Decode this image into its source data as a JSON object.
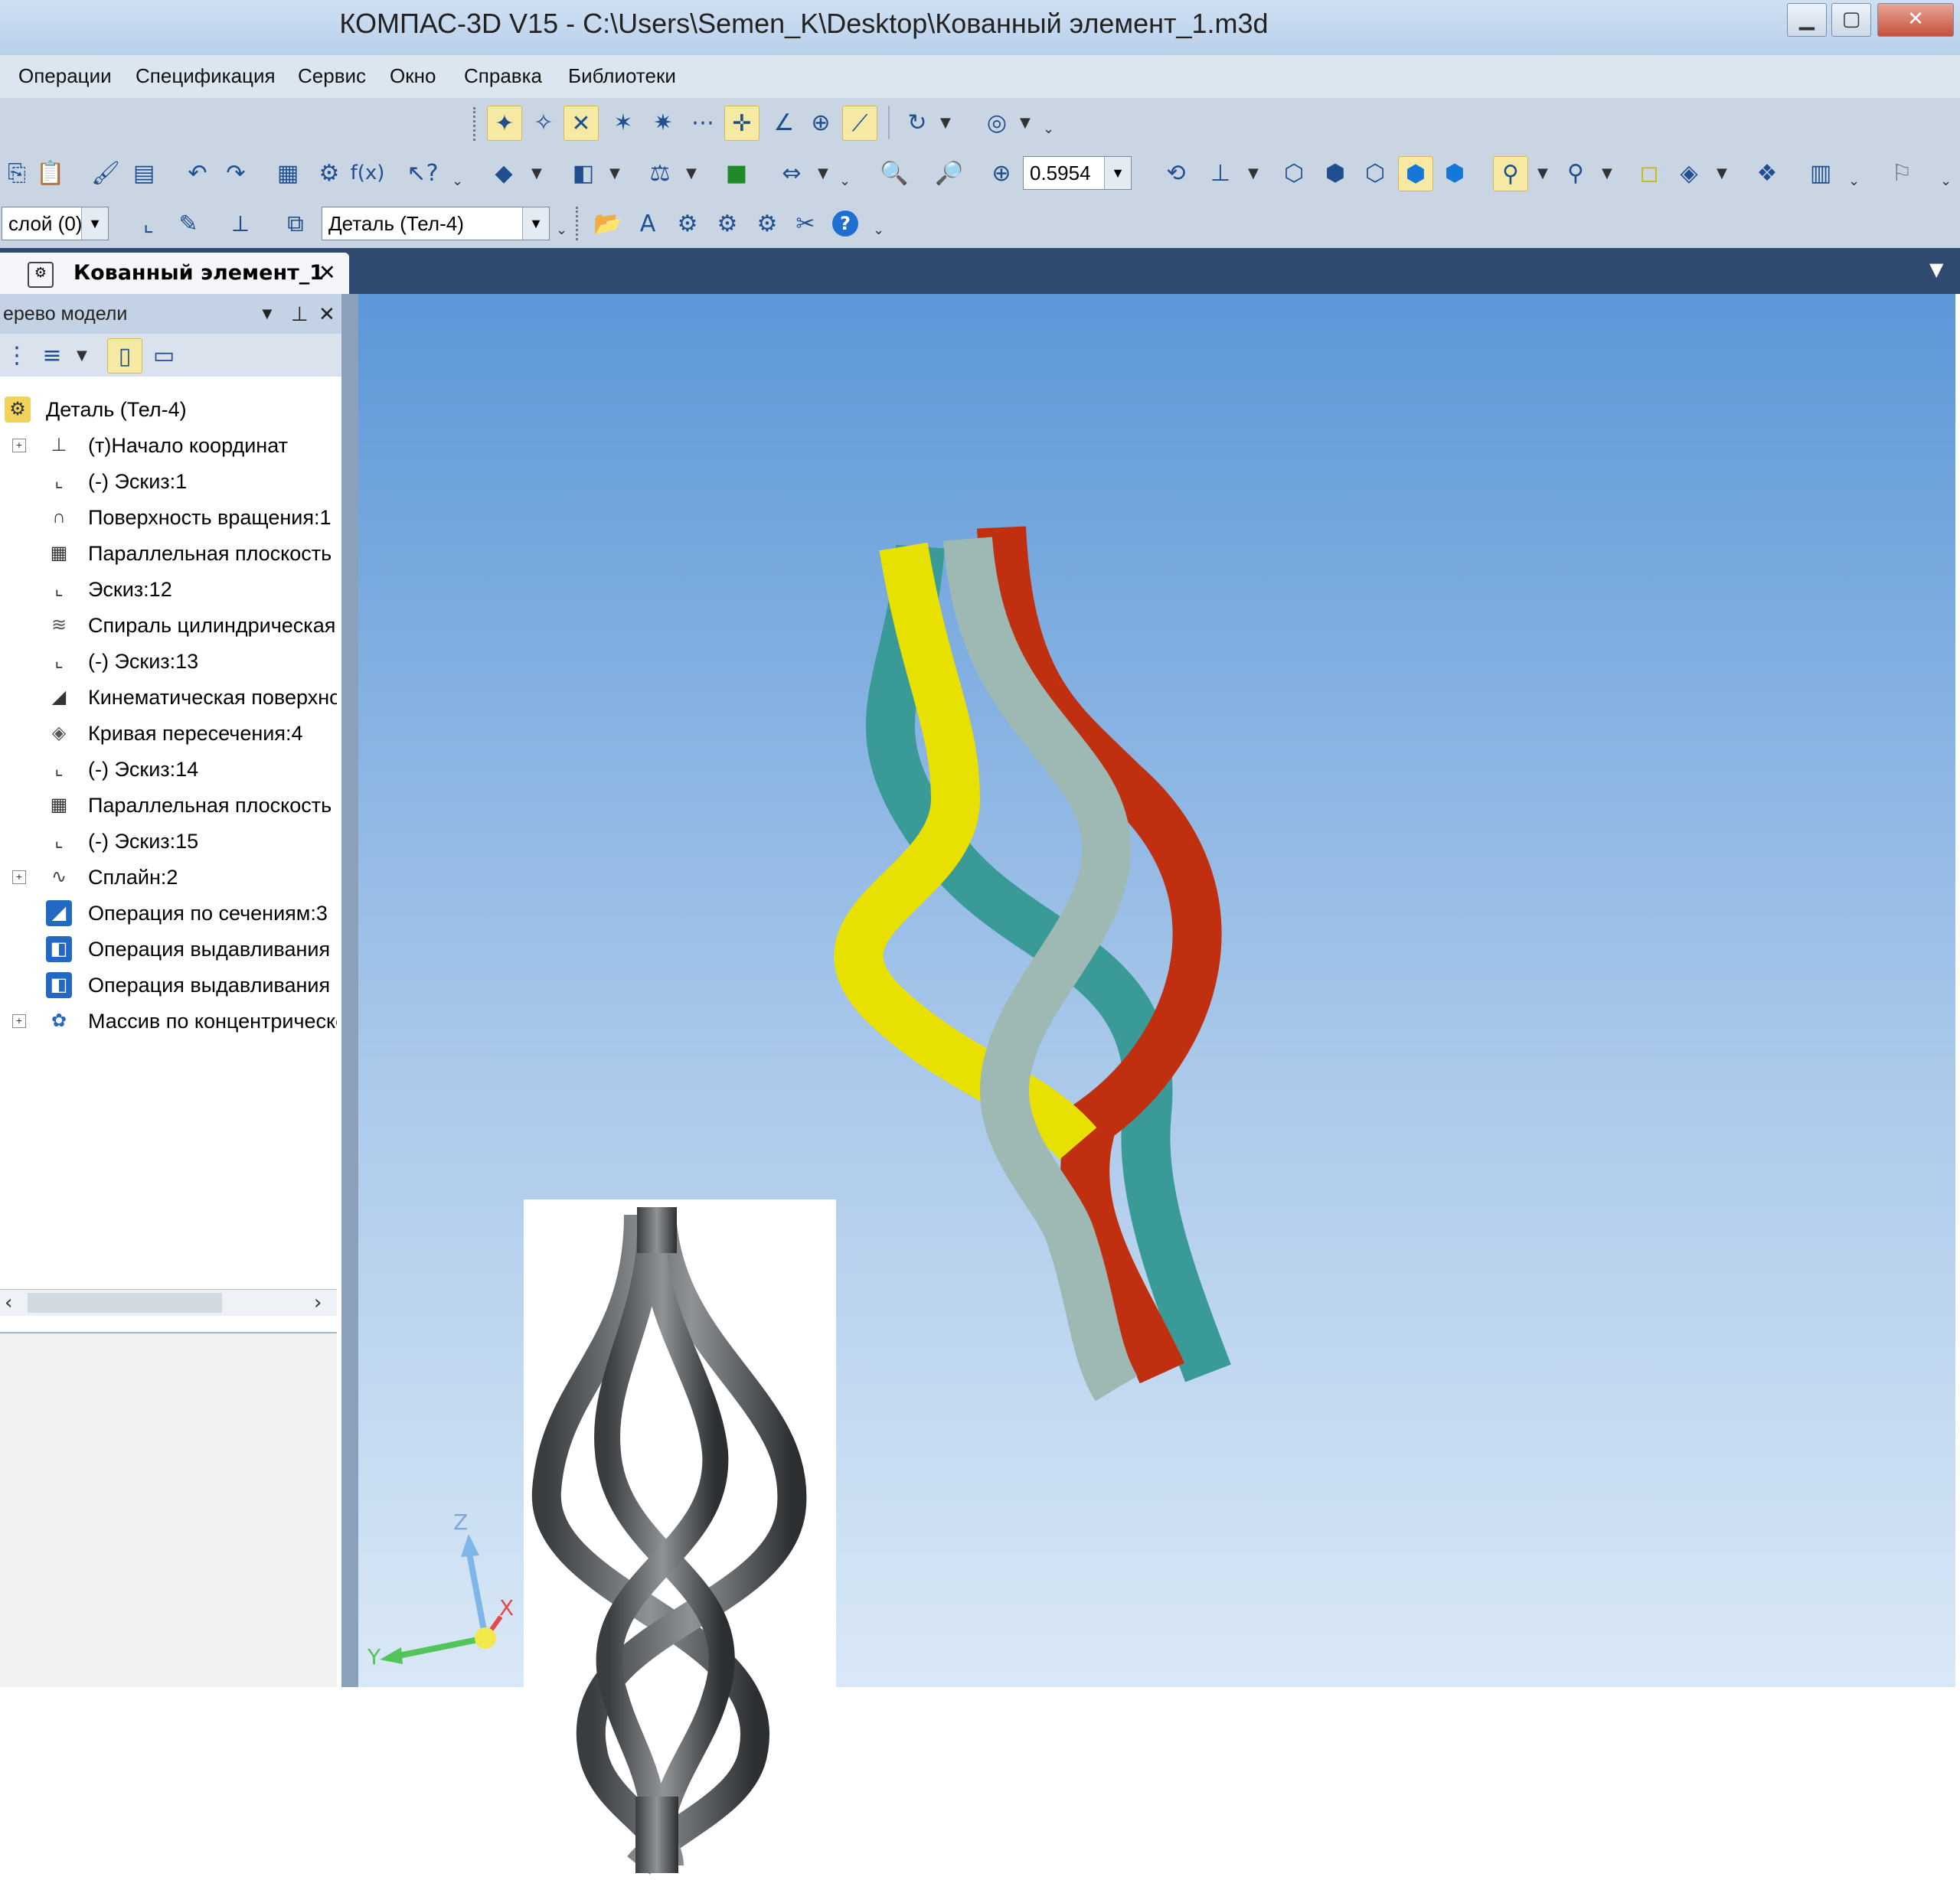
{
  "screen": {
    "window": {
      "title": "КОМПАС-3D V15 - C:\\Users\\Semen_K\\Desktop\\Кованный элемент_1.m3d",
      "minimize_glyph": "▁",
      "maximize_glyph": "▢",
      "close_glyph": "✕"
    },
    "menubar": {
      "items": [
        "Операции",
        "Спецификация",
        "Сервис",
        "Окно",
        "Справка",
        "Библиотеки"
      ]
    },
    "toolbar2": {
      "zoom_value": "0.5954"
    },
    "toolbar3": {
      "layer_combo": "слой (0)",
      "part_combo": "Деталь (Тел-4)"
    },
    "document_tab": {
      "label": "Кованный элемент_1",
      "close_glyph": "✕"
    },
    "tree_panel": {
      "title": "ерево модели",
      "root": "Деталь (Тел-4)",
      "items": [
        {
          "label": "(т)Начало координат",
          "icon": "axes-icon",
          "expandable": true
        },
        {
          "label": "(-) Эскиз:1",
          "icon": "sketch-icon",
          "expandable": false
        },
        {
          "label": "Поверхность вращения:1",
          "icon": "revolve-surface-icon",
          "expandable": false
        },
        {
          "label": "Параллельная плоскость",
          "icon": "plane-icon",
          "expandable": false
        },
        {
          "label": "Эскиз:12",
          "icon": "sketch-icon",
          "expandable": false
        },
        {
          "label": "Спираль цилиндрическая",
          "icon": "helix-icon",
          "expandable": false
        },
        {
          "label": "(-) Эскиз:13",
          "icon": "sketch-icon",
          "expandable": false
        },
        {
          "label": "Кинематическая поверхность",
          "icon": "sweep-surface-icon",
          "expandable": false
        },
        {
          "label": "Кривая пересечения:4",
          "icon": "intersection-curve-icon",
          "expandable": false
        },
        {
          "label": "(-) Эскиз:14",
          "icon": "sketch-icon",
          "expandable": false
        },
        {
          "label": "Параллельная плоскость",
          "icon": "plane-icon",
          "expandable": false
        },
        {
          "label": "(-) Эскиз:15",
          "icon": "sketch-icon",
          "expandable": false
        },
        {
          "label": "Сплайн:2",
          "icon": "spline-icon",
          "expandable": true
        },
        {
          "label": "Операция по сечениям:3",
          "icon": "loft-icon",
          "expandable": false
        },
        {
          "label": "Операция выдавливания",
          "icon": "extrude-icon",
          "expandable": false
        },
        {
          "label": "Операция выдавливания",
          "icon": "extrude-icon",
          "expandable": false
        },
        {
          "label": "Массив по концентрической сетке",
          "icon": "pattern-icon",
          "expandable": true
        }
      ]
    },
    "viewport": {
      "axis_labels": {
        "z": "Z",
        "x": "X",
        "y": "Y"
      },
      "colors": {
        "bar_yellow": "#e8e000",
        "bar_gray": "#9eb8b4",
        "bar_red": "#c03010",
        "bar_teal": "#3a9a98"
      }
    }
  }
}
